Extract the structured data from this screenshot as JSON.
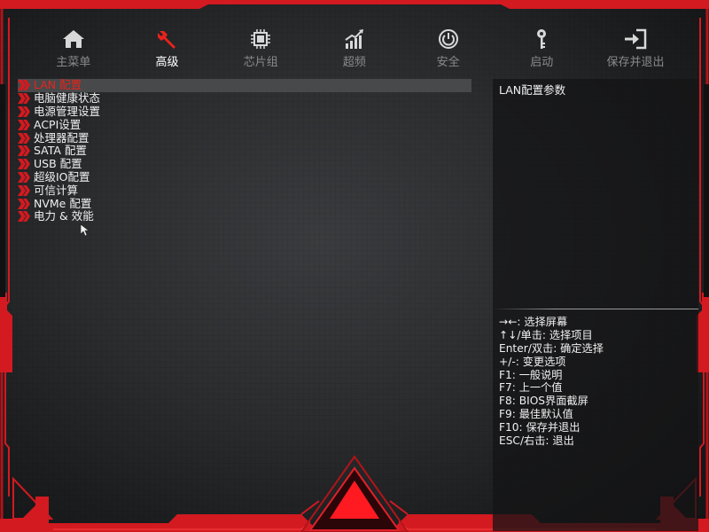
{
  "nav": {
    "tabs": [
      {
        "label": "主菜单",
        "icon": "home-icon"
      },
      {
        "label": "高级",
        "icon": "wrench-icon",
        "active": true
      },
      {
        "label": "芯片组",
        "icon": "chip-icon"
      },
      {
        "label": "超频",
        "icon": "performance-chart-icon"
      },
      {
        "label": "安全",
        "icon": "power-shield-icon"
      },
      {
        "label": "启动",
        "icon": "key-icon"
      },
      {
        "label": "保存并退出",
        "icon": "exit-icon"
      }
    ]
  },
  "menu": {
    "items": [
      {
        "label": "LAN 配置",
        "selected": true
      },
      {
        "label": "电脑健康状态"
      },
      {
        "label": "电源管理设置"
      },
      {
        "label": "ACPI设置"
      },
      {
        "label": "处理器配置"
      },
      {
        "label": "SATA 配置"
      },
      {
        "label": "USB 配置"
      },
      {
        "label": "超级IO配置"
      },
      {
        "label": "可信计算"
      },
      {
        "label": "NVMe 配置"
      },
      {
        "label": "电力 & 效能"
      }
    ]
  },
  "help": {
    "title": "LAN配置参数",
    "keys": [
      "→←: 选择屏幕",
      "↑↓/单击: 选择项目",
      "Enter/双击: 确定选择",
      "+/-: 变更选项",
      "F1: 一般说明",
      "F7: 上一个值",
      "F8: BIOS界面截屏",
      "F9: 最佳默认值",
      "F10: 保存并退出",
      "ESC/右击: 退出"
    ]
  },
  "colors": {
    "accent": "#e8231c",
    "frame": "#c8161d",
    "text": "#f0f0f0",
    "inactive_tab": "#8a8a8a"
  }
}
